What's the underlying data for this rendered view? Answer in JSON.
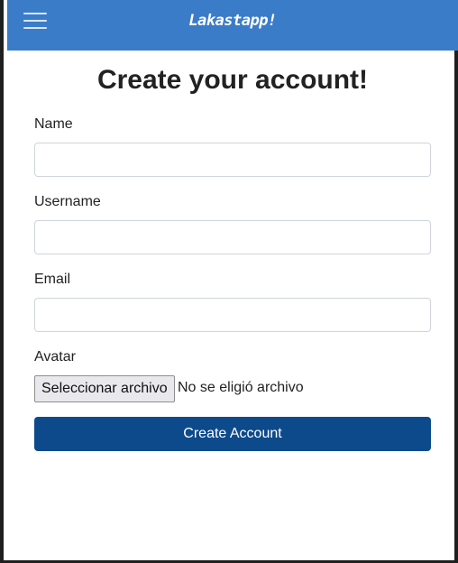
{
  "navbar": {
    "brand": "Lakastapp!",
    "menu_icon": "hamburger-menu-icon"
  },
  "form": {
    "title": "Create your account!",
    "name_label": "Name",
    "name_value": "",
    "username_label": "Username",
    "username_value": "",
    "email_label": "Email",
    "email_value": "",
    "avatar_label": "Avatar",
    "file_button_label": "Seleccionar archivo",
    "file_status": "No se eligió archivo",
    "submit_label": "Create Account"
  },
  "colors": {
    "navbar": "#3b7cc9",
    "submit_button": "#0d4a8b"
  }
}
